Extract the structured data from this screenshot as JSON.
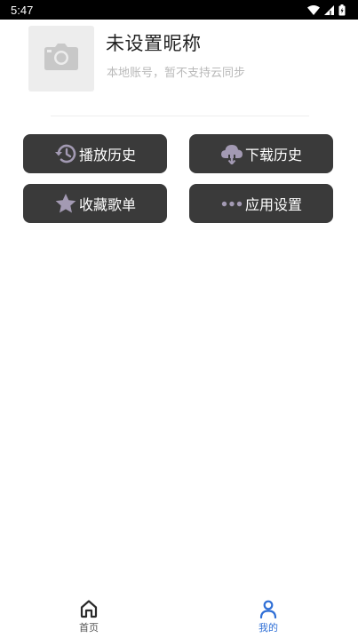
{
  "status_bar": {
    "time": "5:47"
  },
  "profile": {
    "avatar_icon": "camera-icon",
    "nickname": "未设置昵称",
    "account_desc": "本地账号，暂不支持云同步"
  },
  "features": {
    "history": {
      "label": "播放历史",
      "icon": "history-icon"
    },
    "download": {
      "label": "下载历史",
      "icon": "cloud-download-icon"
    },
    "favorites": {
      "label": "收藏歌单",
      "icon": "star-icon"
    },
    "settings": {
      "label": "应用设置",
      "icon": "more-dots-icon"
    }
  },
  "bottom_nav": {
    "items": [
      {
        "label": "首页",
        "icon": "home-icon",
        "active": false
      },
      {
        "label": "我的",
        "icon": "user-icon",
        "active": true
      }
    ]
  },
  "colors": {
    "button_bg": "#3a3a3a",
    "icon_tint": "#a39ab3",
    "active_tab": "#2f6fd6"
  }
}
